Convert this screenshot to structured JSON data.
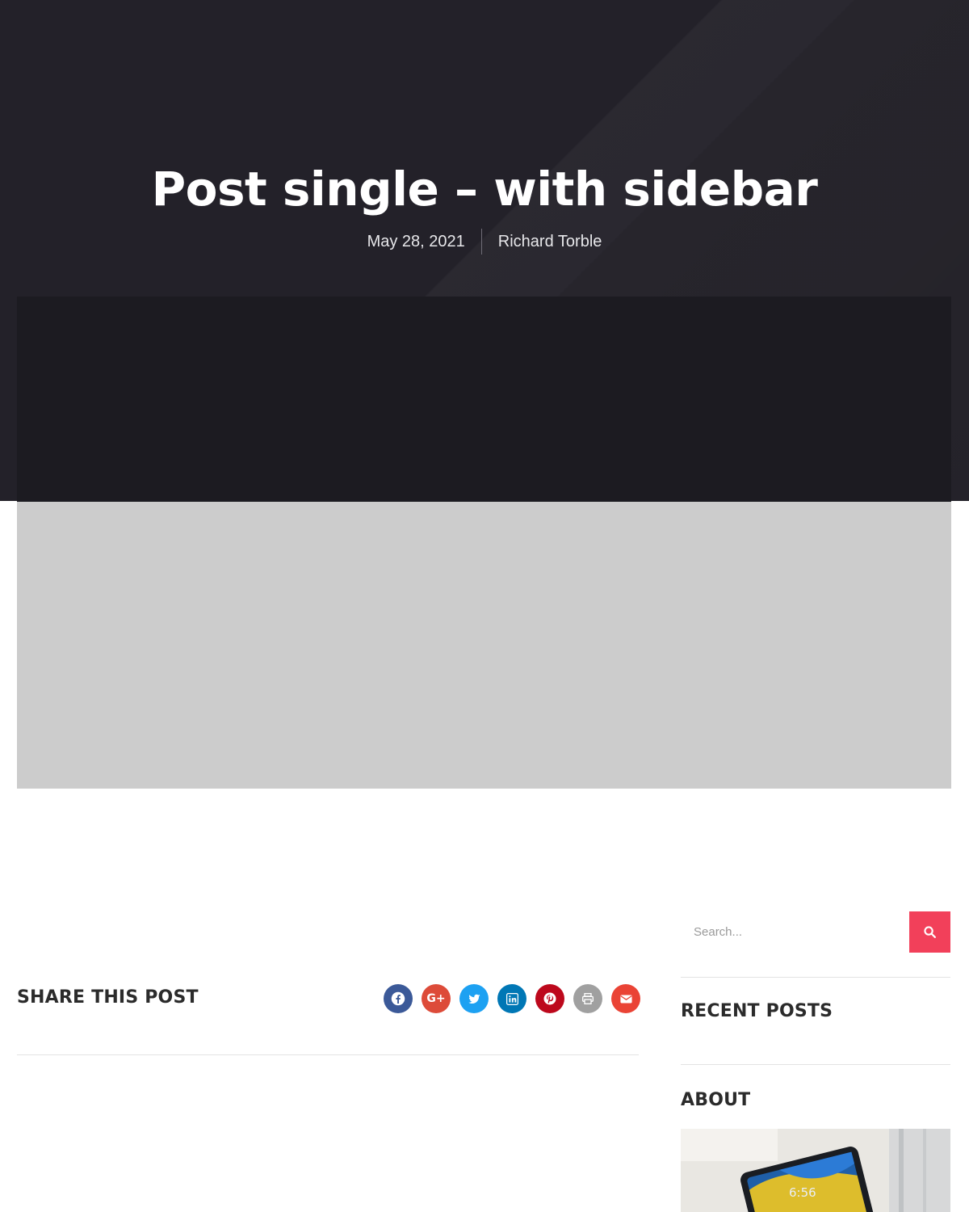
{
  "post": {
    "title": "Post single – with sidebar",
    "date": "May 28, 2021",
    "author": "Richard Torble"
  },
  "share": {
    "title": "SHARE THIS POST",
    "buttons": [
      {
        "name": "facebook",
        "icon": "facebook-icon",
        "color": "#3b5998"
      },
      {
        "name": "google-plus",
        "icon": "google-plus-icon",
        "color": "#dd4b39",
        "glyph": "G+"
      },
      {
        "name": "twitter",
        "icon": "twitter-icon",
        "color": "#1da1f2"
      },
      {
        "name": "linkedin",
        "icon": "linkedin-icon",
        "color": "#0077b5"
      },
      {
        "name": "pinterest",
        "icon": "pinterest-icon",
        "color": "#bd081c"
      },
      {
        "name": "print",
        "icon": "print-icon",
        "color": "#a0a0a0"
      },
      {
        "name": "email",
        "icon": "email-icon",
        "color": "#ea4335"
      }
    ]
  },
  "sidebar": {
    "search": {
      "placeholder": "Search..."
    },
    "recent_posts_title": "RECENT POSTS",
    "about_title": "ABOUT",
    "about_image_clock": "6:56"
  },
  "colors": {
    "hero_bg": "#232129",
    "accent": "#f2405a",
    "feature_placeholder": "#cccccc"
  }
}
